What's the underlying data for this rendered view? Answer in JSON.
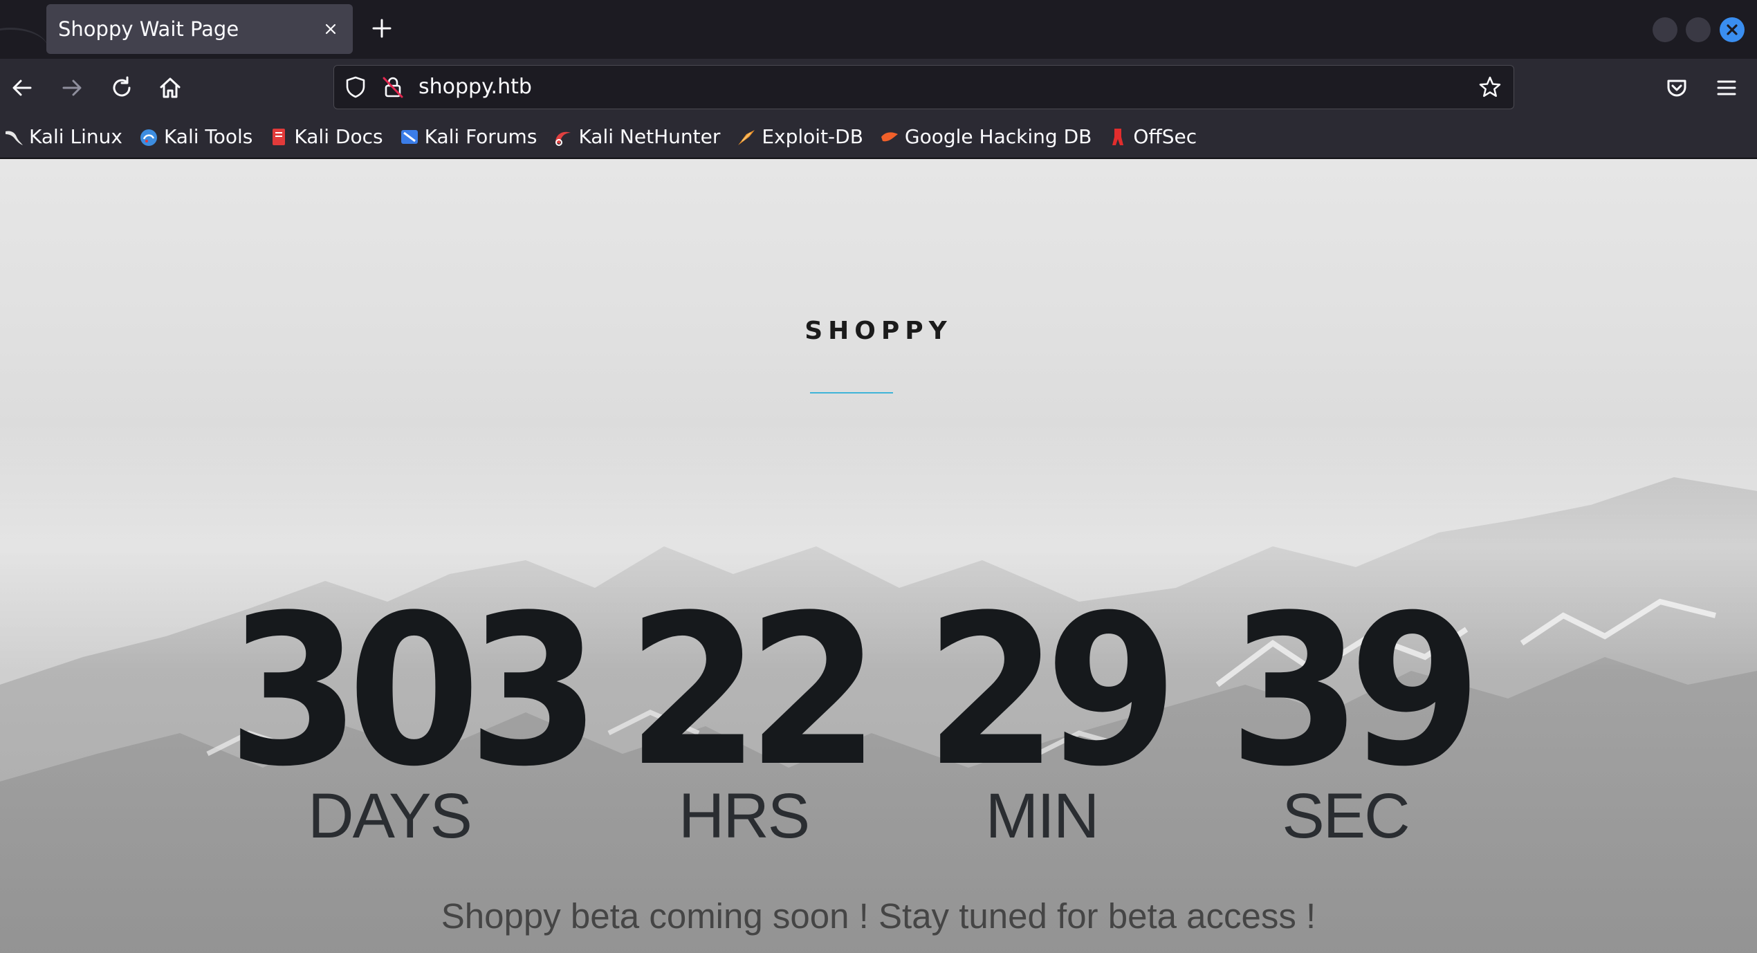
{
  "browser": {
    "tab_title": "Shoppy Wait Page",
    "url": "shoppy.htb"
  },
  "bookmarks": [
    {
      "label": "Kali Linux",
      "icon": "kali-dragon-icon",
      "color": "#e6e6e6"
    },
    {
      "label": "Kali Tools",
      "icon": "kali-tools-icon",
      "color": "#3d8de0"
    },
    {
      "label": "Kali Docs",
      "icon": "kali-docs-icon",
      "color": "#e23a3a"
    },
    {
      "label": "Kali Forums",
      "icon": "kali-forums-icon",
      "color": "#3b7de8"
    },
    {
      "label": "Kali NetHunter",
      "icon": "nethunter-icon",
      "color": "#e04040"
    },
    {
      "label": "Exploit-DB",
      "icon": "exploit-db-icon",
      "color": "#f0942a"
    },
    {
      "label": "Google Hacking DB",
      "icon": "ghdb-icon",
      "color": "#f0602a"
    },
    {
      "label": "OffSec",
      "icon": "offsec-icon",
      "color": "#e22d2d"
    }
  ],
  "page": {
    "brand": "SHOPPY",
    "countdown": [
      {
        "value": "303",
        "label": "DAYS"
      },
      {
        "value": "22",
        "label": "HRS"
      },
      {
        "value": "29",
        "label": "MIN"
      },
      {
        "value": "39",
        "label": "SEC"
      }
    ],
    "footer": "Shoppy beta coming soon ! Stay tuned for beta access !"
  },
  "colors": {
    "accent_rule": "#3fb4d8",
    "close_button": "#3a8ef0"
  }
}
